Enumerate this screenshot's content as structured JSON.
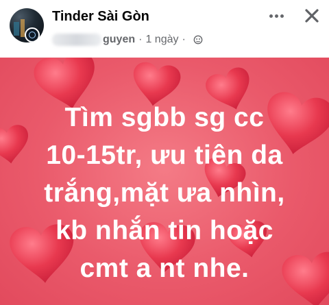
{
  "post": {
    "group_name": "Tinder Sài Gòn",
    "author_name_visible": "guyen",
    "time": "1 ngày",
    "separator": "·",
    "privacy_icon": "globe-icon",
    "more_icon": "more-dots-icon",
    "close_icon": "close-icon"
  },
  "content": {
    "lines": [
      "Tìm sgbb sg cc",
      "10-15tr, ưu tiên da",
      "trắng,mặt ưa nhìn,",
      "kb nhắn tin hoặc",
      "cmt a nt nhe."
    ]
  },
  "colors": {
    "background_pink": "#ea5a6b",
    "heart_red": "#e8394f",
    "text": "#ffffff",
    "meta_gray": "#65676b"
  }
}
